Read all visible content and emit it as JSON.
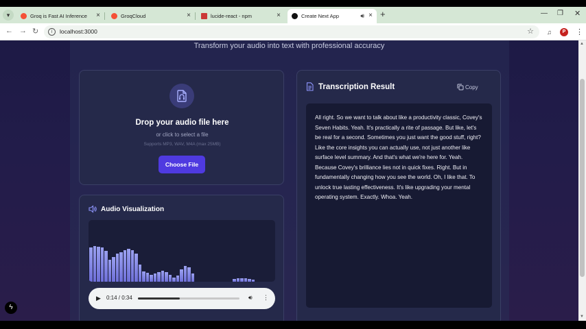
{
  "browser": {
    "tabs": [
      {
        "title": "Groq is Fast AI Inference",
        "favicon_color": "#f55036"
      },
      {
        "title": "GroqCloud",
        "favicon_color": "#f55036"
      },
      {
        "title": "lucide-react - npm",
        "favicon_color": "#cb3837"
      },
      {
        "title": "Create Next App",
        "favicon_color": "#111111"
      }
    ],
    "url": "localhost:3000",
    "profile_initial": "P"
  },
  "page": {
    "subtitle": "Transform your audio into text with professional accuracy",
    "upload": {
      "title": "Drop your audio file here",
      "subtitle": "or click to select a file",
      "supported": "Supports MP3, WAV, M4A (max 25MB)",
      "button_label": "Choose File"
    },
    "visualization": {
      "title": "Audio Visualization",
      "bar_levels": [
        0.56,
        0.58,
        0.57,
        0.55,
        0.5,
        0.36,
        0.4,
        0.45,
        0.48,
        0.51,
        0.53,
        0.51,
        0.45,
        0.28,
        0.17,
        0.14,
        0.11,
        0.13,
        0.15,
        0.18,
        0.16,
        0.11,
        0.07,
        0.1,
        0.2,
        0.25,
        0.23,
        0.13,
        0,
        0,
        0,
        0,
        0,
        0,
        0,
        0,
        0,
        0,
        0.04,
        0.05,
        0.06,
        0.05,
        0.04,
        0.03
      ]
    },
    "player": {
      "time": "0:14 / 0:34",
      "progress": 0.41
    },
    "result": {
      "title": "Transcription Result",
      "copy_label": "Copy",
      "transcript": "All right. So we want to talk about like a productivity classic, Covey's Seven Habits. Yeah. It's practically a rite of passage. But like, let's be real for a second. Sometimes you just want the good stuff, right? Like the core insights you can actually use, not just another like surface level summary. And that's what we're here for. Yeah. Because Covey's brilliance lies not in quick fixes. Right. But in fundamentally changing how you see the world. Oh, I like that. To unlock true lasting effectiveness. It's like upgrading your mental operating system. Exactly. Whoa. Yeah."
    }
  }
}
